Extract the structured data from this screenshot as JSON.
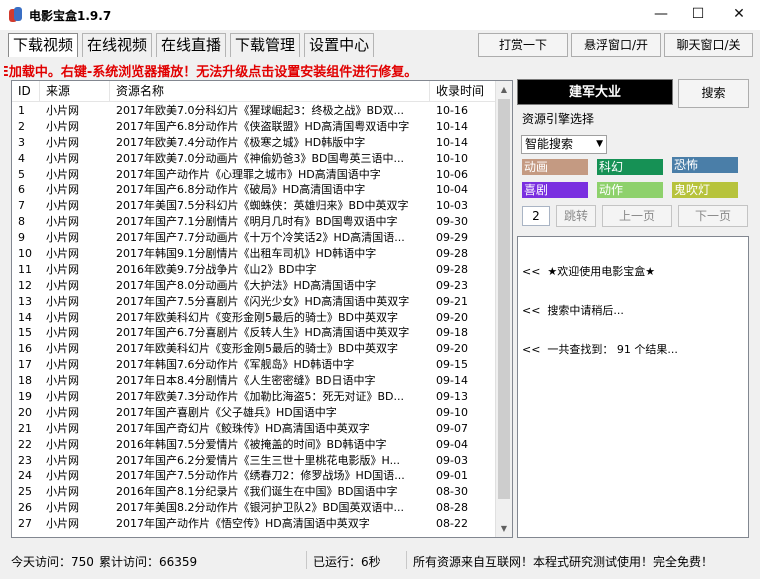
{
  "window": {
    "title": "电影宝盒1.9.7",
    "minimize": "—",
    "maximize": "☐",
    "close": "✕"
  },
  "tabs": [
    "下载视频",
    "在线视频",
    "在线直播",
    "下载管理",
    "设置中心"
  ],
  "top_buttons": {
    "donate": "打赏一下",
    "float": "悬浮窗口/开",
    "chat": "聊天窗口/关"
  },
  "notice": "E加载中。右键-系统浏览器播放！无法升级点击设置安装组件进行修复。",
  "list": {
    "columns": [
      "ID",
      "来源",
      "资源名称",
      "收录时间"
    ],
    "rows": [
      [
        "1",
        "小片网",
        "2017年欧美7.0分科幻片《猩球崛起3：终极之战》BD双...",
        "10-16"
      ],
      [
        "2",
        "小片网",
        "2017年国产6.8分动作片《侠盗联盟》HD高清国粤双语中字",
        "10-14"
      ],
      [
        "3",
        "小片网",
        "2017年欧美7.4分动作片《极寒之城》HD韩版中字",
        "10-14"
      ],
      [
        "4",
        "小片网",
        "2017年欧美7.0分动画片《神偷奶爸3》BD国粤英三语中...",
        "10-10"
      ],
      [
        "5",
        "小片网",
        "2017年国产动作片《心理罪之城市》HD高清国语中字",
        "10-06"
      ],
      [
        "6",
        "小片网",
        "2017年国产6.8分动作片《破局》HD高清国语中字",
        "10-04"
      ],
      [
        "7",
        "小片网",
        "2017年美国7.5分科幻片《蜘蛛侠：英雄归来》BD中英双字",
        "10-03"
      ],
      [
        "8",
        "小片网",
        "2017年国产7.1分剧情片《明月几时有》BD国粤双语中字",
        "09-30"
      ],
      [
        "9",
        "小片网",
        "2017年国产7.7分动画片《十万个冷笑话2》HD高清国语...",
        "09-29"
      ],
      [
        "10",
        "小片网",
        "2017年韩国9.1分剧情片《出租车司机》HD韩语中字",
        "09-28"
      ],
      [
        "11",
        "小片网",
        "2016年欧美9.7分战争片《山2》BD中字",
        "09-28"
      ],
      [
        "12",
        "小片网",
        "2017年国产8.0分动画片《大护法》HD高清国语中字",
        "09-23"
      ],
      [
        "13",
        "小片网",
        "2017年国产7.5分喜剧片《闪光少女》HD高清国语中英双字",
        "09-21"
      ],
      [
        "14",
        "小片网",
        "2017年欧美科幻片《变形金刚5最后的骑士》BD中英双字",
        "09-20"
      ],
      [
        "15",
        "小片网",
        "2017年国产6.7分喜剧片《反转人生》HD高清国语中英双字",
        "09-18"
      ],
      [
        "16",
        "小片网",
        "2017年欧美科幻片《变形金刚5最后的骑士》BD中英双字",
        "09-20"
      ],
      [
        "17",
        "小片网",
        "2017年韩国7.6分动作片《军舰岛》HD韩语中字",
        "09-15"
      ],
      [
        "18",
        "小片网",
        "2017年日本8.4分剧情片《人生密密缝》BD日语中字",
        "09-14"
      ],
      [
        "19",
        "小片网",
        "2017年欧美7.3分动作片《加勒比海盗5：死无对证》BD...",
        "09-13"
      ],
      [
        "20",
        "小片网",
        "2017年国产喜剧片《父子雄兵》HD国语中字",
        "09-10"
      ],
      [
        "21",
        "小片网",
        "2017年国产奇幻片《鲛珠传》HD高清国语中英双字",
        "09-07"
      ],
      [
        "22",
        "小片网",
        "2016年韩国7.5分爱情片《被掩盖的时间》BD韩语中字",
        "09-04"
      ],
      [
        "23",
        "小片网",
        "2017年国产6.2分爱情片《三生三世十里桃花电影版》H...",
        "09-03"
      ],
      [
        "24",
        "小片网",
        "2017年国产7.5分动作片《绣春刀2：修罗战场》HD国语...",
        "09-01"
      ],
      [
        "25",
        "小片网",
        "2016年国产8.1分纪录片《我们诞生在中国》BD国语中字",
        "08-30"
      ],
      [
        "26",
        "小片网",
        "2017年美国8.2分动作片《银河护卫队2》BD国英双语中...",
        "08-28"
      ],
      [
        "27",
        "小片网",
        "2017年国产动作片《悟空传》HD高清国语中英双字",
        "08-22"
      ]
    ]
  },
  "search": {
    "query": "建军大业",
    "button": "搜索"
  },
  "engine": {
    "label": "资源引擎选择",
    "selected": "智能搜索"
  },
  "categories": [
    {
      "label": "动画",
      "color": "#c49a82"
    },
    {
      "label": "科幻",
      "color": "#169155"
    },
    {
      "label": "恐怖",
      "color": "#4a7ea8"
    },
    {
      "label": "喜剧",
      "color": "#7a2fe0"
    },
    {
      "label": "动作",
      "color": "#8ed16c"
    },
    {
      "label": "鬼吹灯",
      "color": "#b7c33c"
    }
  ],
  "pager": {
    "page": "2",
    "jump": "跳转",
    "prev": "上一页",
    "next": "下一页"
  },
  "log": {
    "lines": [
      "<<  ★欢迎使用电影宝盒★",
      "<<  搜索中请稍后...",
      "<<  一共查找到： 91 个结果..."
    ]
  },
  "status": {
    "today": "今天访问：750",
    "total": "累计访问：66359",
    "running": "已运行：6秒",
    "note": "所有资源来自互联网！本程式研究测试使用！完全免费！"
  }
}
